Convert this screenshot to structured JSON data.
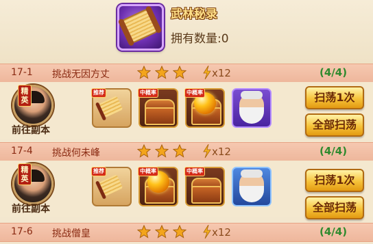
{
  "header": {
    "title": "武林秘录",
    "count_label": "拥有数量:",
    "count_value": "0"
  },
  "buttons": {
    "goto_label": "前往副本",
    "elite_tag": "精英",
    "sweep_once": "扫荡1次",
    "sweep_all": "全部扫荡"
  },
  "loot_badges": {
    "recommend": "推荐",
    "big_chance": "中概率"
  },
  "stages": [
    {
      "num": "17-1",
      "name": "挑战无因方丈",
      "stars": 3,
      "energy": "x12",
      "progress": "(4/4)"
    },
    {
      "num": "17-4",
      "name": "挑战何未峰",
      "stars": 3,
      "energy": "x12",
      "progress": "(4/4)"
    },
    {
      "num": "17-6",
      "name": "挑战僧皇",
      "stars": 3,
      "energy": "x12",
      "progress": "(4/4)"
    }
  ],
  "colors": {
    "star": "#f3a51c",
    "progress_green": "#2f8a2e",
    "bar_text": "#8a2a12"
  }
}
